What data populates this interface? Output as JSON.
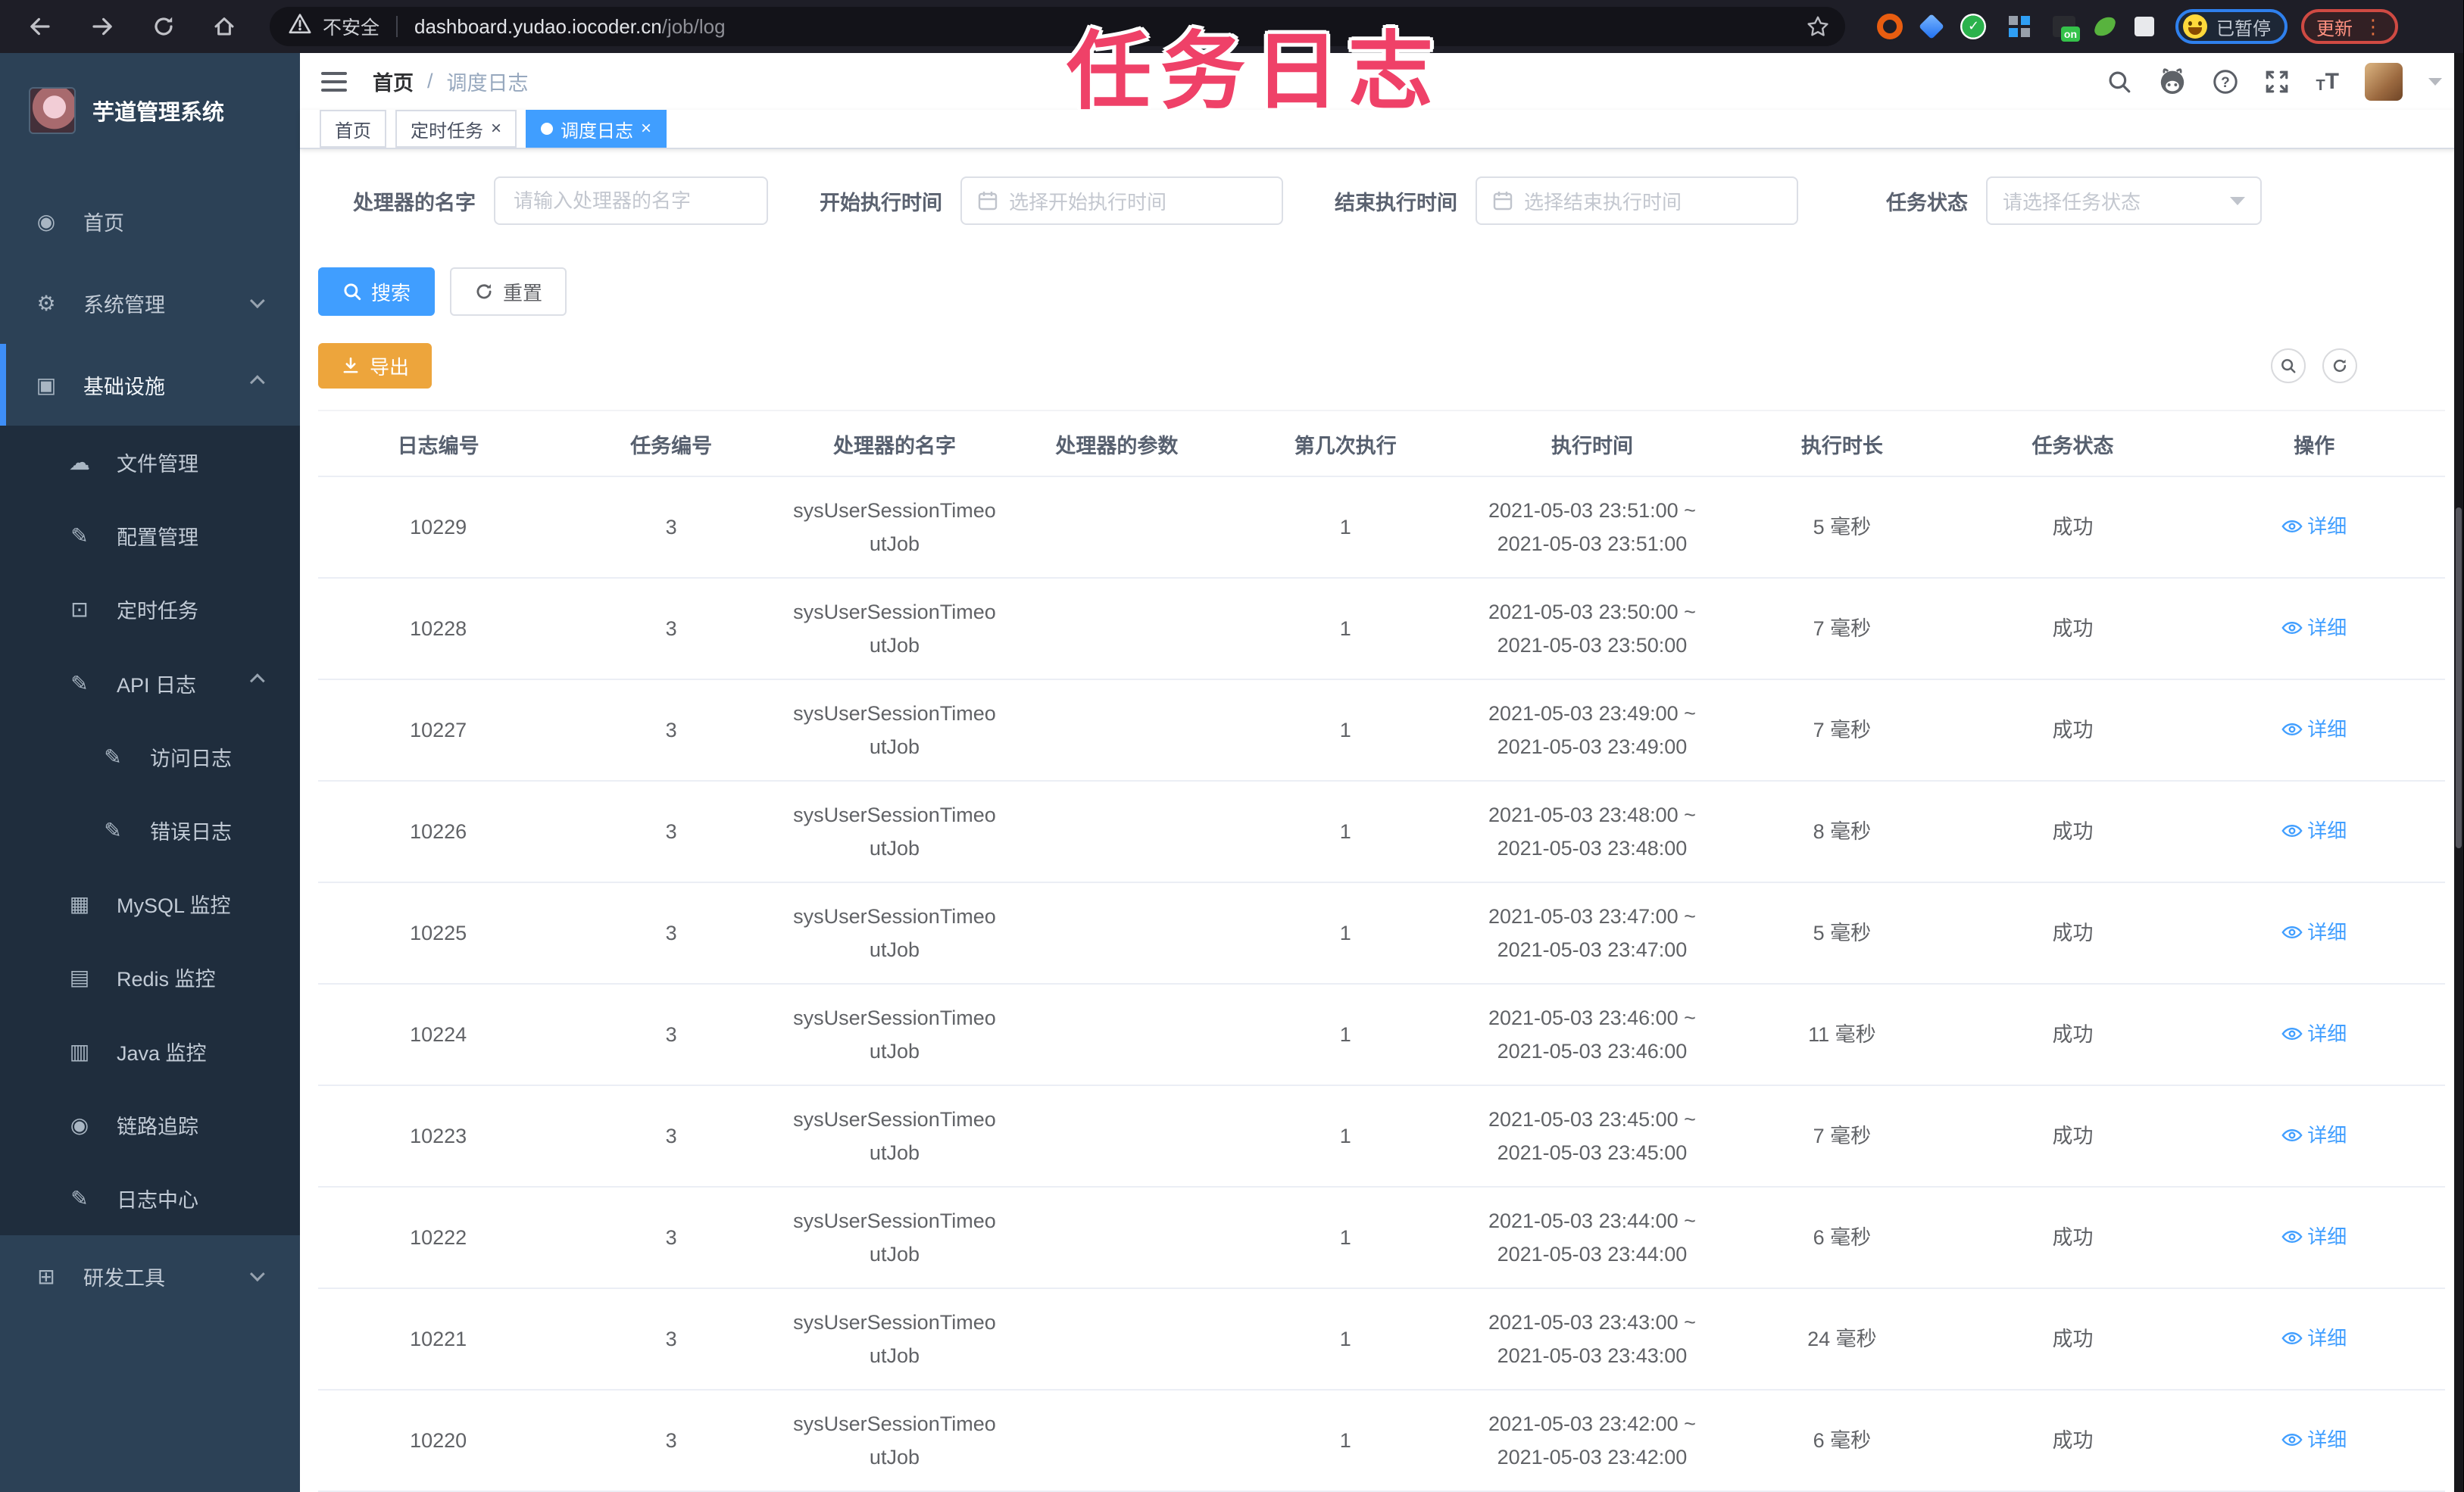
{
  "browser": {
    "security_label": "不安全",
    "url_host": "dashboard.yudao.iocoder.cn",
    "url_path": "/job/log",
    "extension_icons": [
      "orange-ring",
      "blue-gem",
      "green-check",
      "grid",
      "on-badge",
      "leaf",
      "puzzle"
    ],
    "paused_badge": "已暂停",
    "update_label": "更新"
  },
  "page": {
    "annotation": "任务日志"
  },
  "colors": {
    "primary": "#409eff",
    "warning": "#eda53c",
    "sidebar_bg": "#2c4156",
    "sidebar_submenu_bg": "#1f2d3d",
    "annotation": "#ef4168",
    "link": "#409eff",
    "active_tab_bg": "#409eff"
  },
  "sidebar": {
    "title": "芋道管理系统",
    "items": [
      {
        "name": "home",
        "label": "首页",
        "icon": "dashboard",
        "level": 1
      },
      {
        "name": "system-admin",
        "label": "系统管理",
        "icon": "gear",
        "level": 1,
        "chevron": "down"
      },
      {
        "name": "infrastructure",
        "label": "基础设施",
        "icon": "monitor",
        "level": 1,
        "chevron": "up",
        "active": true
      },
      {
        "name": "file-management",
        "label": "文件管理",
        "icon": "cloud",
        "level": 2,
        "sub": true
      },
      {
        "name": "config-management",
        "label": "配置管理",
        "icon": "edit",
        "level": 2,
        "sub": true
      },
      {
        "name": "scheduled-tasks",
        "label": "定时任务",
        "icon": "timer",
        "level": 2,
        "sub": true
      },
      {
        "name": "api-log",
        "label": "API 日志",
        "icon": "edit",
        "level": 2,
        "sub": true,
        "chevron": "up"
      },
      {
        "name": "access-log",
        "label": "访问日志",
        "icon": "edit",
        "level": 3,
        "sub": true
      },
      {
        "name": "error-log",
        "label": "错误日志",
        "icon": "edit",
        "level": 3,
        "sub": true
      },
      {
        "name": "mysql-monitor",
        "label": "MySQL 监控",
        "icon": "chart",
        "level": 2,
        "sub": true
      },
      {
        "name": "redis-monitor",
        "label": "Redis 监控",
        "icon": "layers",
        "level": 2,
        "sub": true
      },
      {
        "name": "java-monitor",
        "label": "Java 监控",
        "icon": "screen",
        "level": 2,
        "sub": true
      },
      {
        "name": "trace",
        "label": "链路追踪",
        "icon": "eye",
        "level": 2,
        "sub": true
      },
      {
        "name": "log-center",
        "label": "日志中心",
        "icon": "edit",
        "level": 2,
        "sub": true
      },
      {
        "name": "dev-tools",
        "label": "研发工具",
        "icon": "tools",
        "level": 1,
        "chevron": "down"
      }
    ]
  },
  "topbar": {
    "breadcrumb": [
      {
        "label": "首页"
      },
      {
        "label": "调度日志"
      }
    ],
    "breadcrumb_separator": "/"
  },
  "tabs": [
    {
      "name": "home",
      "label": "首页"
    },
    {
      "name": "scheduled-tasks",
      "label": "定时任务",
      "closable": true
    },
    {
      "name": "job-log",
      "label": "调度日志",
      "closable": true,
      "active": true
    }
  ],
  "filters": [
    {
      "name": "handler-name",
      "label": "处理器的名字",
      "placeholder": "请输入处理器的名字",
      "control": "text"
    },
    {
      "name": "start-time",
      "label": "开始执行时间",
      "placeholder": "选择开始执行时间",
      "control": "date"
    },
    {
      "name": "end-time",
      "label": "结束执行时间",
      "placeholder": "选择结束执行时间",
      "control": "date"
    },
    {
      "name": "job-status",
      "label": "任务状态",
      "placeholder": "请选择任务状态",
      "control": "select"
    }
  ],
  "buttons": {
    "search": "搜索",
    "reset": "重置",
    "export": "导出"
  },
  "table": {
    "columns": [
      "日志编号",
      "任务编号",
      "处理器的名字",
      "处理器的参数",
      "第几次执行",
      "执行时间",
      "执行时长",
      "任务状态",
      "操作"
    ],
    "detail_label": "详细",
    "rows": [
      {
        "log_id": "10229",
        "job_id": "3",
        "handler": "sysUserSessionTimeoutJob",
        "param": "",
        "execute_index": "1",
        "begin_time": "2021-05-03 23:51:00 ~",
        "end_time": "2021-05-03 23:51:00",
        "duration": "5 毫秒",
        "status": "成功"
      },
      {
        "log_id": "10228",
        "job_id": "3",
        "handler": "sysUserSessionTimeoutJob",
        "param": "",
        "execute_index": "1",
        "begin_time": "2021-05-03 23:50:00 ~",
        "end_time": "2021-05-03 23:50:00",
        "duration": "7 毫秒",
        "status": "成功"
      },
      {
        "log_id": "10227",
        "job_id": "3",
        "handler": "sysUserSessionTimeoutJob",
        "param": "",
        "execute_index": "1",
        "begin_time": "2021-05-03 23:49:00 ~",
        "end_time": "2021-05-03 23:49:00",
        "duration": "7 毫秒",
        "status": "成功"
      },
      {
        "log_id": "10226",
        "job_id": "3",
        "handler": "sysUserSessionTimeoutJob",
        "param": "",
        "execute_index": "1",
        "begin_time": "2021-05-03 23:48:00 ~",
        "end_time": "2021-05-03 23:48:00",
        "duration": "8 毫秒",
        "status": "成功"
      },
      {
        "log_id": "10225",
        "job_id": "3",
        "handler": "sysUserSessionTimeoutJob",
        "param": "",
        "execute_index": "1",
        "begin_time": "2021-05-03 23:47:00 ~",
        "end_time": "2021-05-03 23:47:00",
        "duration": "5 毫秒",
        "status": "成功"
      },
      {
        "log_id": "10224",
        "job_id": "3",
        "handler": "sysUserSessionTimeoutJob",
        "param": "",
        "execute_index": "1",
        "begin_time": "2021-05-03 23:46:00 ~",
        "end_time": "2021-05-03 23:46:00",
        "duration": "11 毫秒",
        "status": "成功"
      },
      {
        "log_id": "10223",
        "job_id": "3",
        "handler": "sysUserSessionTimeoutJob",
        "param": "",
        "execute_index": "1",
        "begin_time": "2021-05-03 23:45:00 ~",
        "end_time": "2021-05-03 23:45:00",
        "duration": "7 毫秒",
        "status": "成功"
      },
      {
        "log_id": "10222",
        "job_id": "3",
        "handler": "sysUserSessionTimeoutJob",
        "param": "",
        "execute_index": "1",
        "begin_time": "2021-05-03 23:44:00 ~",
        "end_time": "2021-05-03 23:44:00",
        "duration": "6 毫秒",
        "status": "成功"
      },
      {
        "log_id": "10221",
        "job_id": "3",
        "handler": "sysUserSessionTimeoutJob",
        "param": "",
        "execute_index": "1",
        "begin_time": "2021-05-03 23:43:00 ~",
        "end_time": "2021-05-03 23:43:00",
        "duration": "24 毫秒",
        "status": "成功"
      },
      {
        "log_id": "10220",
        "job_id": "3",
        "handler": "sysUserSessionTimeoutJob",
        "param": "",
        "execute_index": "1",
        "begin_time": "2021-05-03 23:42:00 ~",
        "end_time": "2021-05-03 23:42:00",
        "duration": "6 毫秒",
        "status": "成功"
      }
    ]
  }
}
